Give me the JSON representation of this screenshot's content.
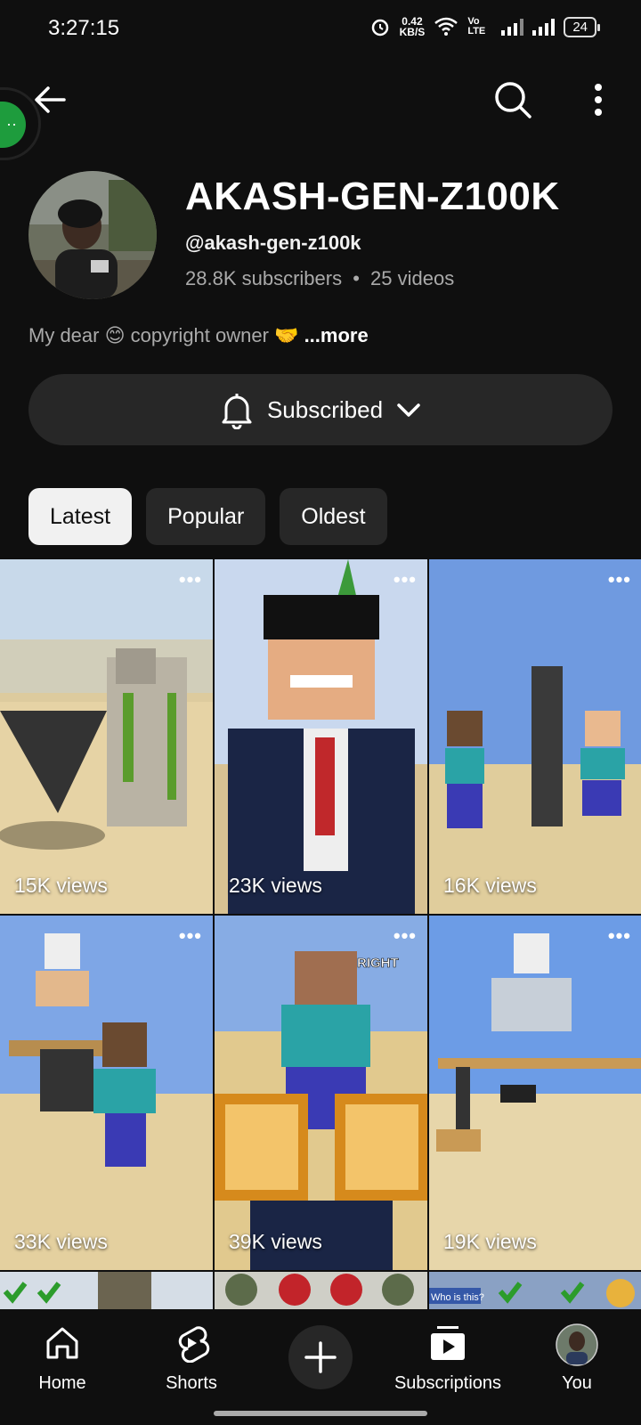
{
  "status": {
    "time": "3:27:15",
    "net_speed": "0.42",
    "net_unit": "KB/S",
    "lte_label": "Vo LTE",
    "battery": "24"
  },
  "channel": {
    "name": "AKASH-GEN-Z100K",
    "handle": "@akash-gen-z100k",
    "subscribers": "28.8K subscribers",
    "separator": "•",
    "videos": "25 videos",
    "description": "My dear 😊 copyright owner 🤝",
    "more_label": "...more"
  },
  "subscribe_button": {
    "label": "Subscribed"
  },
  "bubble": {
    "label": "··"
  },
  "chips": [
    {
      "label": "Latest",
      "active": true
    },
    {
      "label": "Popular",
      "active": false
    },
    {
      "label": "Oldest",
      "active": false
    }
  ],
  "shorts": [
    {
      "views": "15K views"
    },
    {
      "views": "23K views"
    },
    {
      "views": "16K views"
    },
    {
      "views": "33K views"
    },
    {
      "views": "39K views"
    },
    {
      "views": "19K views"
    }
  ],
  "tile_menu": "•••",
  "thumb_text": {
    "right_sign": "RIGHT",
    "who_is_this": "Who is this?"
  },
  "nav": {
    "home": "Home",
    "shorts": "Shorts",
    "subscriptions": "Subscriptions",
    "you": "You"
  },
  "colors": {
    "background": "#0f0f0f",
    "chip_active": "#f1f1f1",
    "button_bg": "#272727"
  }
}
